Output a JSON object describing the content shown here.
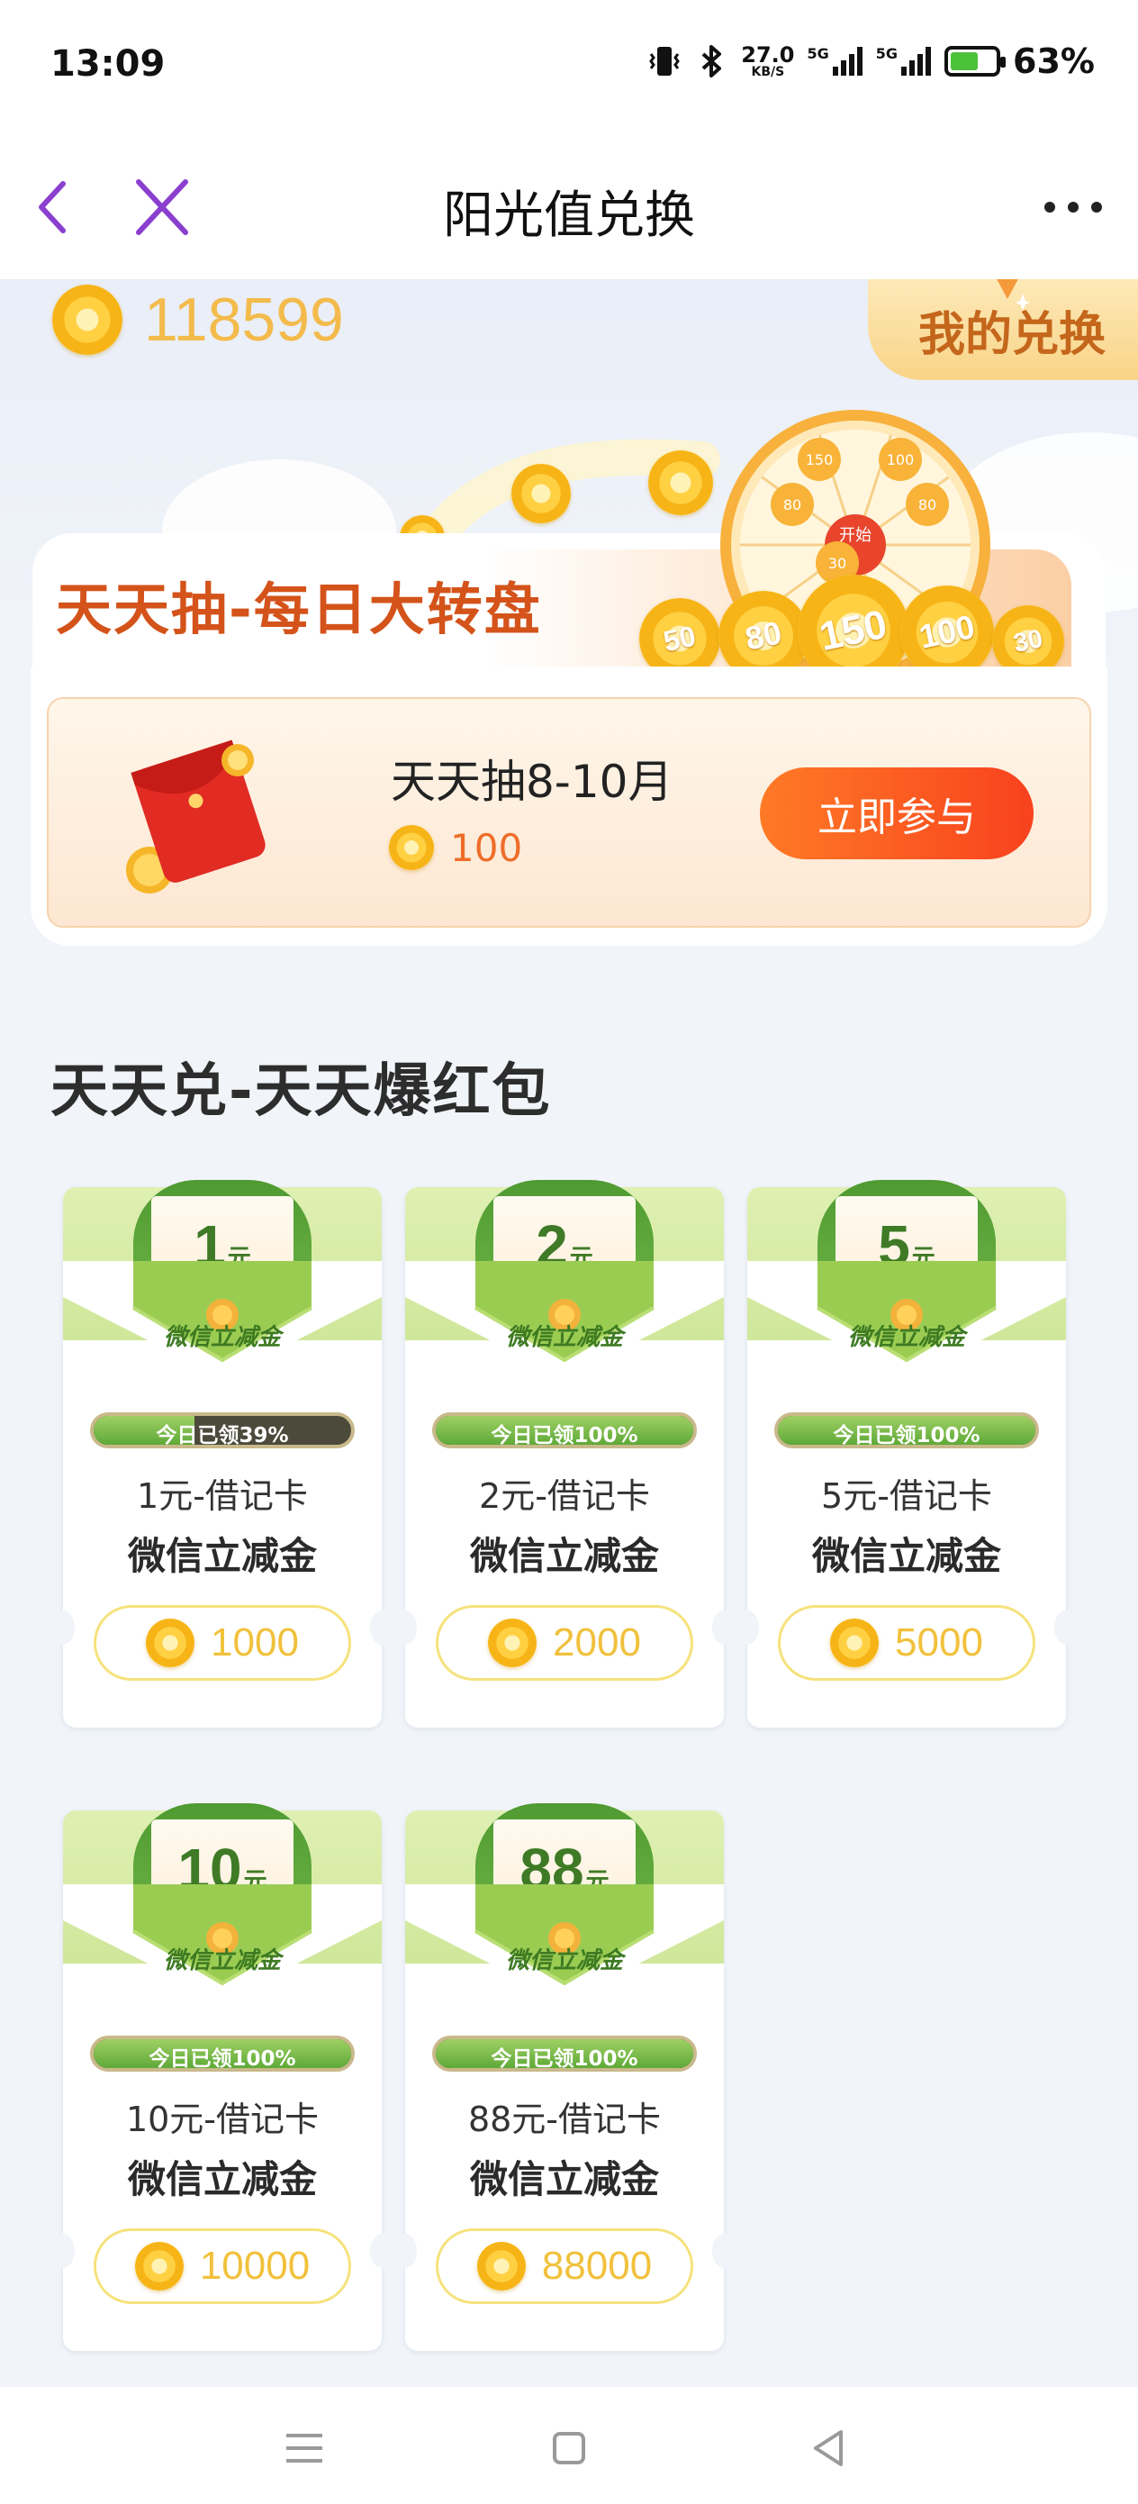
{
  "status_bar": {
    "time": "13:09",
    "net_speed_value": "27.0",
    "net_speed_unit": "KB/S",
    "signal_1_label": "5G",
    "signal_2_label": "5G",
    "battery": "63%",
    "battery_level": 0.63
  },
  "nav": {
    "title": "阳光值兑换",
    "back_icon": "chevron-left-icon",
    "close_icon": "close-icon",
    "more_icon": "more-icon"
  },
  "header": {
    "points": "118599",
    "my_exchange_label": "我的兑换"
  },
  "wheel_banner": {
    "title": "天天抽-每日大转盘",
    "wheel_numbers": [
      "150",
      "100",
      "80",
      "80",
      "30"
    ],
    "center_label": "开始",
    "front_coins": [
      "50",
      "80",
      "150",
      "100",
      "30"
    ]
  },
  "lottery": {
    "name": "天天抽8-10月",
    "cost": "100",
    "button_label": "立即参与"
  },
  "section": {
    "title": "天天兑-天天爆红包"
  },
  "coupon_shared": {
    "envelope_label": "微信立减金",
    "currency_unit": "元"
  },
  "coupons": [
    {
      "amount": "1",
      "claimed_text": "今日已领39%",
      "claimed_fraction": 0.39,
      "name_line1": "1元-借记卡",
      "name_line2": "微信立减金",
      "price": "1000"
    },
    {
      "amount": "2",
      "claimed_text": "今日已领100%",
      "claimed_fraction": 1.0,
      "name_line1": "2元-借记卡",
      "name_line2": "微信立减金",
      "price": "2000"
    },
    {
      "amount": "5",
      "claimed_text": "今日已领100%",
      "claimed_fraction": 1.0,
      "name_line1": "5元-借记卡",
      "name_line2": "微信立减金",
      "price": "5000"
    },
    {
      "amount": "10",
      "claimed_text": "今日已领100%",
      "claimed_fraction": 1.0,
      "name_line1": "10元-借记卡",
      "name_line2": "微信立减金",
      "price": "10000"
    },
    {
      "amount": "88",
      "claimed_text": "今日已领100%",
      "claimed_fraction": 1.0,
      "name_line1": "88元-借记卡",
      "name_line2": "微信立减金",
      "price": "88000"
    }
  ],
  "system_nav": {
    "menu_icon": "menu-icon",
    "home_icon": "home-square-icon",
    "back_icon": "back-triangle-icon"
  },
  "colors": {
    "accent_purple": "#8a3fcf",
    "orange_title": "#d4531a",
    "button_gradient_start": "#ff7a26",
    "button_gradient_end": "#f8421e",
    "coin_gold": "#f3bb4c",
    "envelope_green": "#4f9a32"
  }
}
